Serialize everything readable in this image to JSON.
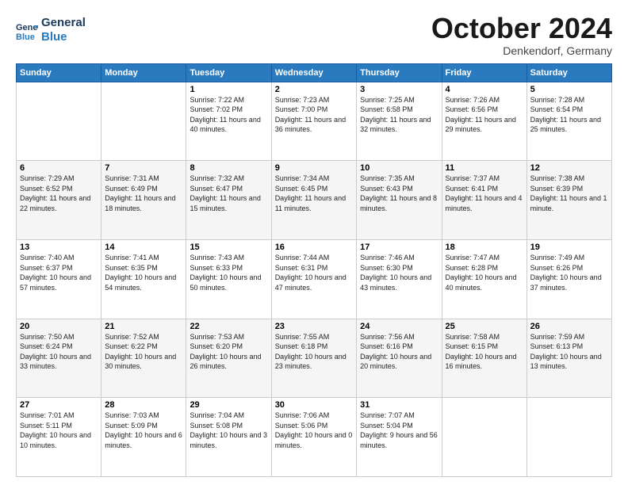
{
  "header": {
    "logo_line1": "General",
    "logo_line2": "Blue",
    "month": "October 2024",
    "location": "Denkendorf, Germany"
  },
  "weekdays": [
    "Sunday",
    "Monday",
    "Tuesday",
    "Wednesday",
    "Thursday",
    "Friday",
    "Saturday"
  ],
  "weeks": [
    [
      {
        "day": "",
        "info": ""
      },
      {
        "day": "",
        "info": ""
      },
      {
        "day": "1",
        "info": "Sunrise: 7:22 AM\nSunset: 7:02 PM\nDaylight: 11 hours and 40 minutes."
      },
      {
        "day": "2",
        "info": "Sunrise: 7:23 AM\nSunset: 7:00 PM\nDaylight: 11 hours and 36 minutes."
      },
      {
        "day": "3",
        "info": "Sunrise: 7:25 AM\nSunset: 6:58 PM\nDaylight: 11 hours and 32 minutes."
      },
      {
        "day": "4",
        "info": "Sunrise: 7:26 AM\nSunset: 6:56 PM\nDaylight: 11 hours and 29 minutes."
      },
      {
        "day": "5",
        "info": "Sunrise: 7:28 AM\nSunset: 6:54 PM\nDaylight: 11 hours and 25 minutes."
      }
    ],
    [
      {
        "day": "6",
        "info": "Sunrise: 7:29 AM\nSunset: 6:52 PM\nDaylight: 11 hours and 22 minutes."
      },
      {
        "day": "7",
        "info": "Sunrise: 7:31 AM\nSunset: 6:49 PM\nDaylight: 11 hours and 18 minutes."
      },
      {
        "day": "8",
        "info": "Sunrise: 7:32 AM\nSunset: 6:47 PM\nDaylight: 11 hours and 15 minutes."
      },
      {
        "day": "9",
        "info": "Sunrise: 7:34 AM\nSunset: 6:45 PM\nDaylight: 11 hours and 11 minutes."
      },
      {
        "day": "10",
        "info": "Sunrise: 7:35 AM\nSunset: 6:43 PM\nDaylight: 11 hours and 8 minutes."
      },
      {
        "day": "11",
        "info": "Sunrise: 7:37 AM\nSunset: 6:41 PM\nDaylight: 11 hours and 4 minutes."
      },
      {
        "day": "12",
        "info": "Sunrise: 7:38 AM\nSunset: 6:39 PM\nDaylight: 11 hours and 1 minute."
      }
    ],
    [
      {
        "day": "13",
        "info": "Sunrise: 7:40 AM\nSunset: 6:37 PM\nDaylight: 10 hours and 57 minutes."
      },
      {
        "day": "14",
        "info": "Sunrise: 7:41 AM\nSunset: 6:35 PM\nDaylight: 10 hours and 54 minutes."
      },
      {
        "day": "15",
        "info": "Sunrise: 7:43 AM\nSunset: 6:33 PM\nDaylight: 10 hours and 50 minutes."
      },
      {
        "day": "16",
        "info": "Sunrise: 7:44 AM\nSunset: 6:31 PM\nDaylight: 10 hours and 47 minutes."
      },
      {
        "day": "17",
        "info": "Sunrise: 7:46 AM\nSunset: 6:30 PM\nDaylight: 10 hours and 43 minutes."
      },
      {
        "day": "18",
        "info": "Sunrise: 7:47 AM\nSunset: 6:28 PM\nDaylight: 10 hours and 40 minutes."
      },
      {
        "day": "19",
        "info": "Sunrise: 7:49 AM\nSunset: 6:26 PM\nDaylight: 10 hours and 37 minutes."
      }
    ],
    [
      {
        "day": "20",
        "info": "Sunrise: 7:50 AM\nSunset: 6:24 PM\nDaylight: 10 hours and 33 minutes."
      },
      {
        "day": "21",
        "info": "Sunrise: 7:52 AM\nSunset: 6:22 PM\nDaylight: 10 hours and 30 minutes."
      },
      {
        "day": "22",
        "info": "Sunrise: 7:53 AM\nSunset: 6:20 PM\nDaylight: 10 hours and 26 minutes."
      },
      {
        "day": "23",
        "info": "Sunrise: 7:55 AM\nSunset: 6:18 PM\nDaylight: 10 hours and 23 minutes."
      },
      {
        "day": "24",
        "info": "Sunrise: 7:56 AM\nSunset: 6:16 PM\nDaylight: 10 hours and 20 minutes."
      },
      {
        "day": "25",
        "info": "Sunrise: 7:58 AM\nSunset: 6:15 PM\nDaylight: 10 hours and 16 minutes."
      },
      {
        "day": "26",
        "info": "Sunrise: 7:59 AM\nSunset: 6:13 PM\nDaylight: 10 hours and 13 minutes."
      }
    ],
    [
      {
        "day": "27",
        "info": "Sunrise: 7:01 AM\nSunset: 5:11 PM\nDaylight: 10 hours and 10 minutes."
      },
      {
        "day": "28",
        "info": "Sunrise: 7:03 AM\nSunset: 5:09 PM\nDaylight: 10 hours and 6 minutes."
      },
      {
        "day": "29",
        "info": "Sunrise: 7:04 AM\nSunset: 5:08 PM\nDaylight: 10 hours and 3 minutes."
      },
      {
        "day": "30",
        "info": "Sunrise: 7:06 AM\nSunset: 5:06 PM\nDaylight: 10 hours and 0 minutes."
      },
      {
        "day": "31",
        "info": "Sunrise: 7:07 AM\nSunset: 5:04 PM\nDaylight: 9 hours and 56 minutes."
      },
      {
        "day": "",
        "info": ""
      },
      {
        "day": "",
        "info": ""
      }
    ]
  ]
}
